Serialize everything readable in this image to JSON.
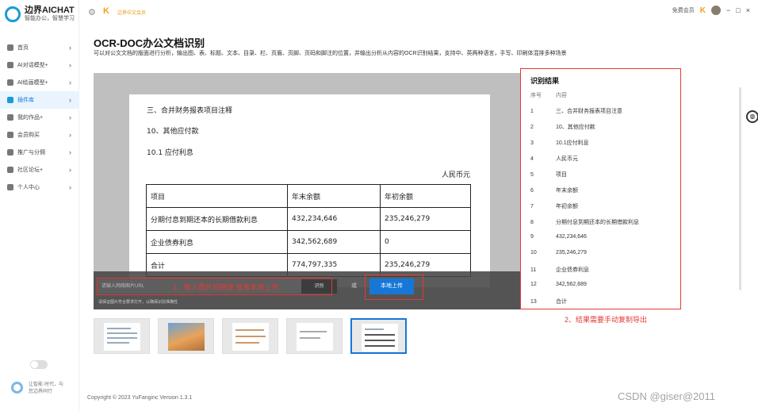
{
  "app": {
    "logo_title": "边界AICHAT",
    "logo_subtitle": "智能办公，智慧学习"
  },
  "sidebar": {
    "items": [
      {
        "label": "首页"
      },
      {
        "label": "AI对话模型+"
      },
      {
        "label": "AI绘画模型+"
      },
      {
        "label": "插件库"
      },
      {
        "label": "我的作品+"
      },
      {
        "label": "会员购买"
      },
      {
        "label": "推广与分佣"
      },
      {
        "label": "社区论坛+"
      },
      {
        "label": "个人中心"
      }
    ],
    "footer_text_line1": "让智能·时代，与",
    "footer_text_line2": "您边界同行"
  },
  "topbar": {
    "promo": "边界中文会员",
    "user_label": "免费会员",
    "minimize": "−",
    "maximize": "□",
    "close": "×"
  },
  "page": {
    "title": "OCR-DOC办公文档识别",
    "description": "可以对公文文档的版面进行分析，输出图、表、标题、文本、目录、栏、页眉、页脚、页码和脚注的位置，并输出分析从内容的OCR识别结果，支持中、英两种语言，手写、印刷体混排多种场景"
  },
  "document": {
    "heading1": "三、合并财务报表项目注释",
    "heading2": "10、其他应付款",
    "heading3": "10.1 应付利息",
    "unit": "人民币元",
    "table": [
      [
        "项目",
        "年末余额",
        "年初余额"
      ],
      [
        "分期付息到期还本的长期借款利息",
        "432,234,646",
        "235,246,279"
      ],
      [
        "企业债券利息",
        "342,562,689",
        "0"
      ],
      [
        "合计",
        "774,797,335",
        "235,246,279"
      ]
    ]
  },
  "upload": {
    "url_placeholder": "请输入网络图片URL",
    "identify_label": "识别",
    "or_text": "或",
    "upload_label": "本地上传",
    "hint": "请保证图片符合要求打开，以确保识别准确性",
    "annotation1": "1、输入图片的链接 或者本地上传"
  },
  "results": {
    "title": "识别结果",
    "col_index": "序号",
    "col_content": "内容",
    "rows": [
      {
        "n": "1",
        "text": "三、合并财务报表项目注意"
      },
      {
        "n": "2",
        "text": "10、其他应付款"
      },
      {
        "n": "3",
        "text": "10.1应付利息"
      },
      {
        "n": "4",
        "text": "人民币元"
      },
      {
        "n": "5",
        "text": "项目"
      },
      {
        "n": "6",
        "text": "年末余额"
      },
      {
        "n": "7",
        "text": "年初余额"
      },
      {
        "n": "8",
        "text": "分期付息到期还本的长期借款利息"
      },
      {
        "n": "9",
        "text": "432,234,646"
      },
      {
        "n": "10",
        "text": "235,246,279"
      },
      {
        "n": "11",
        "text": "企业债券利息"
      },
      {
        "n": "12",
        "text": "342,562,689"
      },
      {
        "n": "13",
        "text": "合计"
      }
    ],
    "annotation2": "2、结果需要手动复制导出"
  },
  "footer": {
    "copyright": "Copyright © 2023 YuFanginc Version 1.3.1"
  },
  "watermark": "CSDN @giser@2011"
}
